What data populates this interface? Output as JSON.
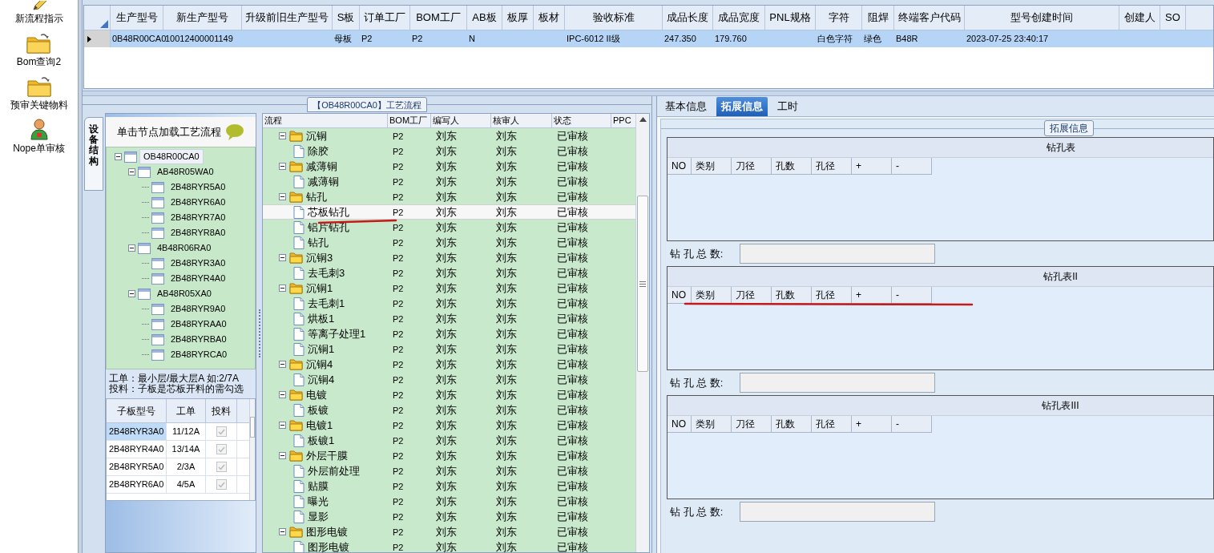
{
  "launcher": [
    {
      "label": "新流程指示",
      "kind": "pencil"
    },
    {
      "label": "Bom查询2",
      "kind": "folder"
    },
    {
      "label": "预审关键物料",
      "kind": "folder"
    },
    {
      "label": "Nope单审核",
      "kind": "person"
    }
  ],
  "top_grid": {
    "columns": [
      "生产型号",
      "新生产型号",
      "升级前旧生产型号",
      "S板",
      "订单工厂",
      "BOM工厂",
      "AB板",
      "板厚",
      "板材",
      "验收标准",
      "成品长度",
      "成品宽度",
      "PNL规格",
      "字符",
      "阻焊",
      "终端客户代码",
      "型号创建时间",
      "创建人",
      "SO"
    ],
    "rows": [
      {
        "selected": true,
        "cells": [
          "0B48R00CA0",
          "10012400001149",
          "",
          "母板",
          "P2",
          "P2",
          "N",
          "",
          "",
          "IPC-6012 II级",
          "247.350",
          "179.760",
          "",
          "白色字符",
          "绿色",
          "B48R",
          "2023-07-25 23:40:17",
          "",
          ""
        ]
      }
    ]
  },
  "process_panel": {
    "title": "【OB48R00CA0】工艺流程",
    "side_tab": "设备结构",
    "hint": "单击节点加载工艺流程",
    "tree": [
      {
        "label": "OB48R00CA0",
        "selected": true,
        "expanded": true,
        "children": [
          {
            "label": "AB48R05WA0",
            "selected": false,
            "expanded": true,
            "children": [
              {
                "label": "2B48RYR5A0",
                "selected": false
              },
              {
                "label": "2B48RYR6A0",
                "selected": false
              },
              {
                "label": "2B48RYR7A0",
                "selected": false
              },
              {
                "label": "2B48RYR8A0",
                "selected": false
              }
            ]
          },
          {
            "label": "4B48R06RA0",
            "selected": false,
            "expanded": true,
            "children": [
              {
                "label": "2B48RYR3A0",
                "selected": false
              },
              {
                "label": "2B48RYR4A0",
                "selected": false
              }
            ]
          },
          {
            "label": "AB48R05XA0",
            "selected": false,
            "expanded": true,
            "children": [
              {
                "label": "2B48RYR9A0",
                "selected": false
              },
              {
                "label": "2B48RYRAA0",
                "selected": false
              },
              {
                "label": "2B48RYRBA0",
                "selected": false
              },
              {
                "label": "2B48RYRCA0",
                "selected": false
              }
            ]
          }
        ]
      }
    ],
    "notes": [
      "工单：最小层/最大层A 如:2/7A",
      "投料：子板是芯板开料的需勾选"
    ],
    "sub_grid": {
      "columns": [
        "子板型号",
        "工单",
        "投料"
      ],
      "rows": [
        {
          "cells": [
            "2B48RYR3A0",
            "11/12A"
          ],
          "checked": true,
          "disabled": true,
          "selected": true
        },
        {
          "cells": [
            "2B48RYR4A0",
            "13/14A"
          ],
          "checked": true,
          "disabled": true,
          "selected": false
        },
        {
          "cells": [
            "2B48RYR5A0",
            "2/3A"
          ],
          "checked": true,
          "disabled": true,
          "selected": false
        },
        {
          "cells": [
            "2B48RYR6A0",
            "4/5A"
          ],
          "checked": true,
          "disabled": true,
          "selected": false
        }
      ]
    }
  },
  "flow_grid": {
    "columns": [
      "流程",
      "BOM工厂",
      "编写人",
      "核审人",
      "状态",
      "PPC"
    ],
    "rows": [
      {
        "label": "沉铜",
        "kind": "folder",
        "expanded": true,
        "selected": false,
        "bom_factory": "P2",
        "author": "刘东",
        "reviewer": "刘东",
        "status": "已审核",
        "children": [
          {
            "label": "除胶",
            "kind": "step",
            "selected": false,
            "bom_factory": "P2",
            "author": "刘东",
            "reviewer": "刘东",
            "status": "已审核"
          }
        ]
      },
      {
        "label": "减薄铜",
        "kind": "folder",
        "expanded": true,
        "selected": false,
        "bom_factory": "P2",
        "author": "刘东",
        "reviewer": "刘东",
        "status": "已审核",
        "children": [
          {
            "label": "减薄铜",
            "kind": "step",
            "selected": false,
            "bom_factory": "P2",
            "author": "刘东",
            "reviewer": "刘东",
            "status": "已审核"
          }
        ]
      },
      {
        "label": "钻孔",
        "kind": "folder",
        "expanded": true,
        "selected": false,
        "bom_factory": "P2",
        "author": "刘东",
        "reviewer": "刘东",
        "status": "已审核",
        "children": [
          {
            "label": "芯板钻孔",
            "kind": "step",
            "selected": true,
            "bom_factory": "P2",
            "author": "刘东",
            "reviewer": "刘东",
            "status": "已审核"
          },
          {
            "label": "铝片钻孔",
            "kind": "step",
            "selected": false,
            "bom_factory": "P2",
            "author": "刘东",
            "reviewer": "刘东",
            "status": "已审核"
          },
          {
            "label": "钻孔",
            "kind": "step",
            "selected": false,
            "bom_factory": "P2",
            "author": "刘东",
            "reviewer": "刘东",
            "status": "已审核"
          }
        ]
      },
      {
        "label": "沉铜3",
        "kind": "folder",
        "expanded": true,
        "selected": false,
        "bom_factory": "P2",
        "author": "刘东",
        "reviewer": "刘东",
        "status": "已审核",
        "children": [
          {
            "label": "去毛刺3",
            "kind": "step",
            "selected": false,
            "bom_factory": "P2",
            "author": "刘东",
            "reviewer": "刘东",
            "status": "已审核"
          }
        ]
      },
      {
        "label": "沉铜1",
        "kind": "folder",
        "expanded": true,
        "selected": false,
        "bom_factory": "P2",
        "author": "刘东",
        "reviewer": "刘东",
        "status": "已审核",
        "children": [
          {
            "label": "去毛刺1",
            "kind": "step",
            "selected": false,
            "bom_factory": "P2",
            "author": "刘东",
            "reviewer": "刘东",
            "status": "已审核"
          },
          {
            "label": "烘板1",
            "kind": "step",
            "selected": false,
            "bom_factory": "P2",
            "author": "刘东",
            "reviewer": "刘东",
            "status": "已审核"
          },
          {
            "label": "等离子处理1",
            "kind": "step",
            "selected": false,
            "bom_factory": "P2",
            "author": "刘东",
            "reviewer": "刘东",
            "status": "已审核"
          },
          {
            "label": "沉铜1",
            "kind": "step",
            "selected": false,
            "bom_factory": "P2",
            "author": "刘东",
            "reviewer": "刘东",
            "status": "已审核"
          }
        ]
      },
      {
        "label": "沉铜4",
        "kind": "folder",
        "expanded": true,
        "selected": false,
        "bom_factory": "P2",
        "author": "刘东",
        "reviewer": "刘东",
        "status": "已审核",
        "children": [
          {
            "label": "沉铜4",
            "kind": "step",
            "selected": false,
            "bom_factory": "P2",
            "author": "刘东",
            "reviewer": "刘东",
            "status": "已审核"
          }
        ]
      },
      {
        "label": "电镀",
        "kind": "folder",
        "expanded": true,
        "selected": false,
        "bom_factory": "P2",
        "author": "刘东",
        "reviewer": "刘东",
        "status": "已审核",
        "children": [
          {
            "label": "板镀",
            "kind": "step",
            "selected": false,
            "bom_factory": "P2",
            "author": "刘东",
            "reviewer": "刘东",
            "status": "已审核"
          }
        ]
      },
      {
        "label": "电镀1",
        "kind": "folder",
        "expanded": true,
        "selected": false,
        "bom_factory": "P2",
        "author": "刘东",
        "reviewer": "刘东",
        "status": "已审核",
        "children": [
          {
            "label": "板镀1",
            "kind": "step",
            "selected": false,
            "bom_factory": "P2",
            "author": "刘东",
            "reviewer": "刘东",
            "status": "已审核"
          }
        ]
      },
      {
        "label": "外层干膜",
        "kind": "folder",
        "expanded": true,
        "selected": false,
        "bom_factory": "P2",
        "author": "刘东",
        "reviewer": "刘东",
        "status": "已审核",
        "children": [
          {
            "label": "外层前处理",
            "kind": "step",
            "selected": false,
            "bom_factory": "P2",
            "author": "刘东",
            "reviewer": "刘东",
            "status": "已审核"
          },
          {
            "label": "贴膜",
            "kind": "step",
            "selected": false,
            "bom_factory": "P2",
            "author": "刘东",
            "reviewer": "刘东",
            "status": "已审核"
          },
          {
            "label": "曝光",
            "kind": "step",
            "selected": false,
            "bom_factory": "P2",
            "author": "刘东",
            "reviewer": "刘东",
            "status": "已审核"
          },
          {
            "label": "显影",
            "kind": "step",
            "selected": false,
            "bom_factory": "P2",
            "author": "刘东",
            "reviewer": "刘东",
            "status": "已审核"
          }
        ]
      },
      {
        "label": "图形电镀",
        "kind": "folder",
        "expanded": true,
        "selected": false,
        "bom_factory": "P2",
        "author": "刘东",
        "reviewer": "刘东",
        "status": "已审核",
        "children": [
          {
            "label": "图形电镀",
            "kind": "step",
            "selected": false,
            "bom_factory": "P2",
            "author": "刘东",
            "reviewer": "刘东",
            "status": "已审核"
          }
        ]
      }
    ]
  },
  "detail_panel": {
    "tabs": [
      {
        "label": "基本信息",
        "selected": false
      },
      {
        "label": "拓展信息",
        "selected": true
      },
      {
        "label": "工时",
        "selected": false
      }
    ],
    "group_title": "拓展信息",
    "drill_tables": [
      {
        "title": "钻孔表",
        "columns": [
          "NO",
          "类别",
          "刀径",
          "孔数",
          "孔径",
          "+",
          "-"
        ],
        "total_label": "钻 孔 总 数:"
      },
      {
        "title": "钻孔表II",
        "columns": [
          "NO",
          "类别",
          "刀径",
          "孔数",
          "孔径",
          "+",
          "-"
        ],
        "total_label": "钻 孔 总 数:"
      },
      {
        "title": "钻孔表III",
        "columns": [
          "NO",
          "类别",
          "刀径",
          "孔数",
          "孔径",
          "+",
          "-"
        ],
        "total_label": "钻 孔 总 数:"
      }
    ]
  }
}
